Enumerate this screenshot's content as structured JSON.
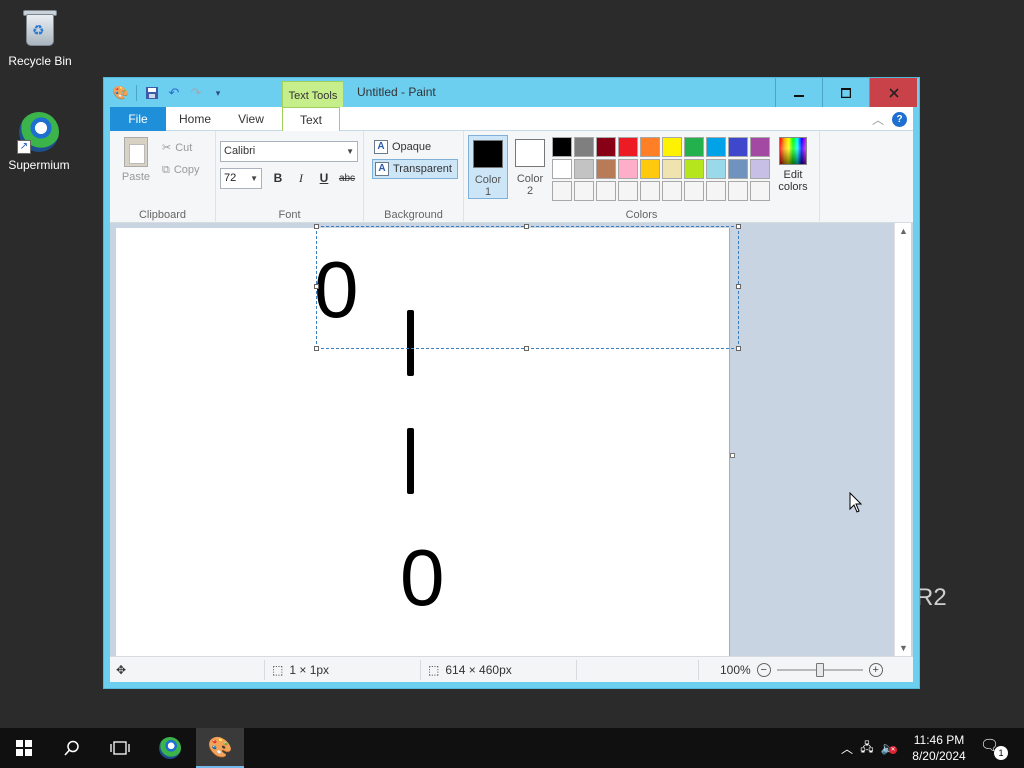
{
  "desktop": {
    "icons": [
      {
        "label": "Recycle Bin"
      },
      {
        "label": "Supermium"
      }
    ],
    "watermark": "R2"
  },
  "window": {
    "title": "Untitled - Paint",
    "context_tab": "Text Tools",
    "buttons": {
      "minimize": "—",
      "maximize": "☐",
      "close": "✕"
    }
  },
  "ribbon": {
    "tabs": [
      "File",
      "Home",
      "View",
      "Text"
    ],
    "active_tab": "Text",
    "clipboard": {
      "paste": "Paste",
      "cut": "Cut",
      "copy": "Copy",
      "label": "Clipboard"
    },
    "font": {
      "family": "Calibri",
      "size": "72",
      "bold": "B",
      "italic": "I",
      "underline": "U",
      "strikethrough": "abc",
      "label": "Font"
    },
    "background": {
      "opaque": "Opaque",
      "transparent": "Transparent",
      "label": "Background",
      "selected": "Transparent"
    },
    "colors": {
      "color1_label_line1": "Color",
      "color1_label_line2": "1",
      "color2_label_line1": "Color",
      "color2_label_line2": "2",
      "color1": "#000000",
      "color2": "#ffffff",
      "edit_label_line1": "Edit",
      "edit_label_line2": "colors",
      "label": "Colors",
      "palette": [
        "#000000",
        "#7f7f7f",
        "#880015",
        "#ed1c24",
        "#ff7f27",
        "#fff200",
        "#22b14c",
        "#00a2e8",
        "#3f48cc",
        "#a349a4",
        "#ffffff",
        "#c3c3c3",
        "#b97a57",
        "#ffaec9",
        "#ffc90e",
        "#efe4b0",
        "#b5e61d",
        "#99d9ea",
        "#7092be",
        "#c8bfe7",
        "#f5f5f5",
        "#f5f5f5",
        "#f5f5f5",
        "#f5f5f5",
        "#f5f5f5",
        "#f5f5f5",
        "#f5f5f5",
        "#f5f5f5",
        "#f5f5f5",
        "#f5f5f5"
      ]
    }
  },
  "canvas": {
    "characters": [
      "0",
      "0"
    ]
  },
  "status": {
    "selection_size": "1 × 1px",
    "image_size": "614 × 460px",
    "zoom": "100%",
    "zoom_level_fraction": 0.5
  },
  "taskbar": {
    "time": "11:46 PM",
    "date": "8/20/2024",
    "notification_count": "1"
  }
}
